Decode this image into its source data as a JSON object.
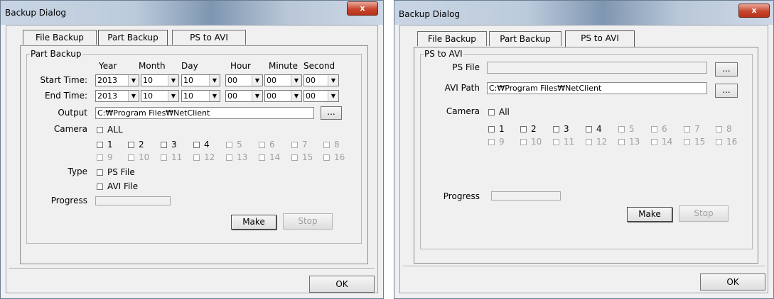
{
  "left": {
    "title": "Backup Dialog",
    "close": "x",
    "tabs": [
      "File Backup",
      "Part Backup",
      "PS to AVI"
    ],
    "group": "Part Backup",
    "headers": {
      "year": "Year",
      "month": "Month",
      "day": "Day",
      "hour": "Hour",
      "minute": "Minute",
      "second": "Second"
    },
    "start_label": "Start Time:",
    "end_label": "End Time:",
    "start": {
      "year": "2013",
      "month": "10",
      "day": "10",
      "hour": "00",
      "minute": "00",
      "second": "00"
    },
    "end": {
      "year": "2013",
      "month": "10",
      "day": "10",
      "hour": "00",
      "minute": "00",
      "second": "00"
    },
    "output_label": "Output",
    "output_value": "C:₩Program Files₩NetClient",
    "browse": "...",
    "camera_label": "Camera",
    "all_label": "ALL",
    "cameras_row1": [
      "1",
      "2",
      "3",
      "4",
      "5",
      "6",
      "7",
      "8"
    ],
    "cameras_row2": [
      "9",
      "10",
      "11",
      "12",
      "13",
      "14",
      "15",
      "16"
    ],
    "type_label": "Type",
    "type_ps": "PS File",
    "type_avi": "AVI File",
    "progress_label": "Progress",
    "progress_value": 0,
    "make": "Make",
    "stop": "Stop",
    "ok": "OK"
  },
  "right": {
    "title": "Backup Dialog",
    "close": "x",
    "tabs": [
      "File Backup",
      "Part Backup",
      "PS to AVI"
    ],
    "group": "PS to AVI",
    "ps_file_label": "PS File",
    "ps_file_value": "",
    "avi_path_label": "AVI Path",
    "avi_path_value": "C:₩Program Files₩NetClient",
    "browse": "...",
    "camera_label": "Camera",
    "all_label": "All",
    "cameras_row1": [
      "1",
      "2",
      "3",
      "4",
      "5",
      "6",
      "7",
      "8"
    ],
    "cameras_row2": [
      "9",
      "10",
      "11",
      "12",
      "13",
      "14",
      "15",
      "16"
    ],
    "progress_label": "Progress",
    "progress_value": 0,
    "make": "Make",
    "stop": "Stop",
    "ok": "OK"
  }
}
